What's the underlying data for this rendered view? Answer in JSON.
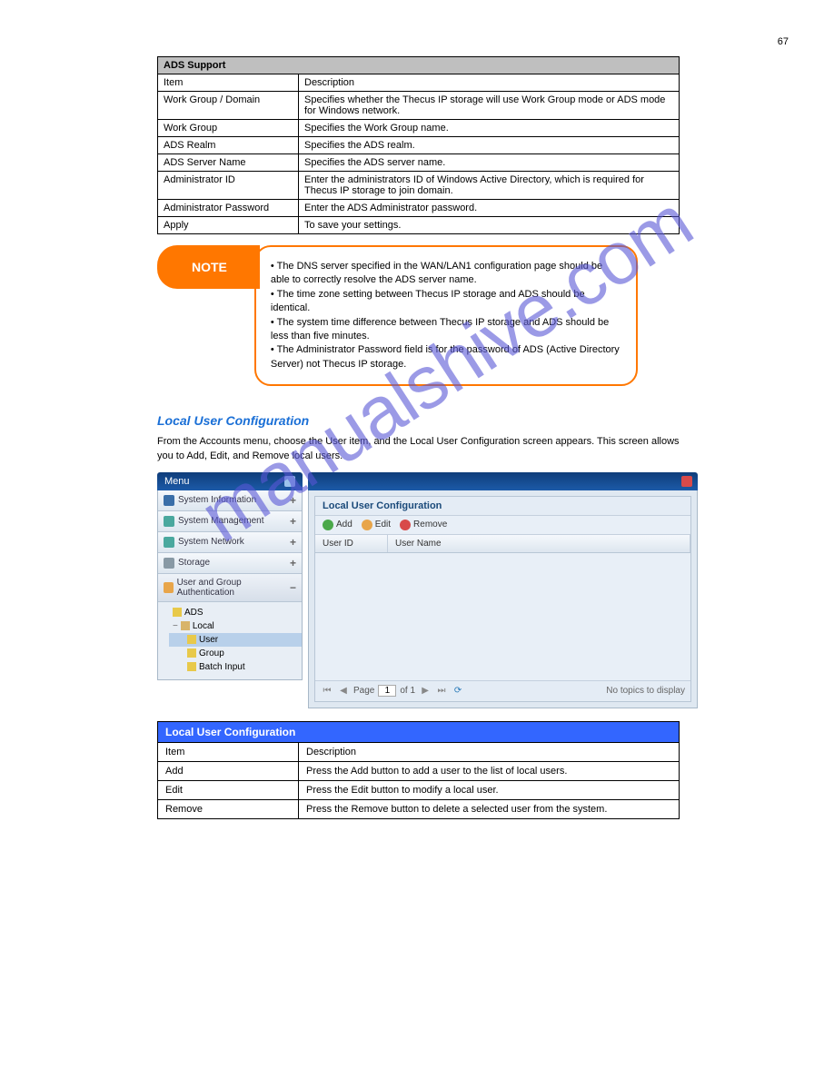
{
  "page_number": "67",
  "watermark": "manualshive.com",
  "ads_table": {
    "header": "ADS Support",
    "rows": [
      {
        "item": "Item",
        "desc": "Description"
      },
      {
        "item": "Work Group / Domain",
        "desc": "Specifies whether the Thecus IP storage will use Work Group mode or ADS mode for Windows network."
      },
      {
        "item": "Work Group",
        "desc": "Specifies the Work Group name."
      },
      {
        "item": "ADS Realm",
        "desc": "Specifies the ADS realm."
      },
      {
        "item": "ADS Server Name",
        "desc": "Specifies the ADS server name."
      },
      {
        "item": "Administrator ID",
        "desc": "Enter the administrators ID of Windows Active Directory, which is required for Thecus IP storage to join domain."
      },
      {
        "item": "Administrator Password",
        "desc": "Enter the ADS Administrator password."
      },
      {
        "item": "Apply",
        "desc": "To save your settings."
      }
    ]
  },
  "note": {
    "label": "NOTE",
    "lines": [
      "• The DNS server specified in the WAN/LAN1 configuration page should be able to correctly resolve the ADS server name.",
      "• The time zone setting between Thecus IP storage and ADS should be identical.",
      "• The system time difference between Thecus IP storage and ADS should be less than five minutes.",
      "• The Administrator Password field is for the password of ADS (Active Directory Server) not Thecus IP storage."
    ]
  },
  "local_user_section": {
    "heading": "Local User Configuration",
    "intro": "From the Accounts menu, choose the User item, and the Local User Configuration screen appears. This screen allows you to Add, Edit, and Remove local users.",
    "after": "Local User Configuration"
  },
  "screenshot": {
    "menu": {
      "title": "Menu",
      "items": [
        {
          "label": "System Information",
          "icon": "ico-blue",
          "plus": "+"
        },
        {
          "label": "System Management",
          "icon": "ico-teal",
          "plus": "+"
        },
        {
          "label": "System Network",
          "icon": "ico-teal",
          "plus": "+"
        },
        {
          "label": "Storage",
          "icon": "ico-gray",
          "plus": "+"
        },
        {
          "label": "User and Group Authentication",
          "icon": "ico-orange",
          "plus": "−"
        }
      ],
      "tree": [
        {
          "label": "ADS",
          "icon": "ico-green"
        },
        {
          "label": "Local",
          "icon": "ico-tan",
          "expand": "−"
        },
        {
          "label": "User",
          "icon": "ico-green",
          "indent": 1,
          "selected": true
        },
        {
          "label": "Group",
          "icon": "ico-green",
          "indent": 1
        },
        {
          "label": "Batch Input",
          "icon": "ico-green",
          "indent": 1
        }
      ]
    },
    "content": {
      "panel_title": "Local User Configuration",
      "toolbar": {
        "add": "Add",
        "edit": "Edit",
        "remove": "Remove"
      },
      "grid_headers": [
        "User ID",
        "User Name"
      ],
      "pager": {
        "page_label": "Page",
        "page_value": "1",
        "of_label": "of 1",
        "message": "No topics to display"
      }
    }
  },
  "luc_table": {
    "header": "Local User Configuration",
    "rows": [
      {
        "item": "Item",
        "desc": "Description"
      },
      {
        "item": "Add",
        "desc": "Press the Add button to add a user to the list of local users."
      },
      {
        "item": "Edit",
        "desc": "Press the Edit button to modify a local user."
      },
      {
        "item": "Remove",
        "desc": "Press the Remove button to delete a selected user from the system."
      }
    ]
  }
}
